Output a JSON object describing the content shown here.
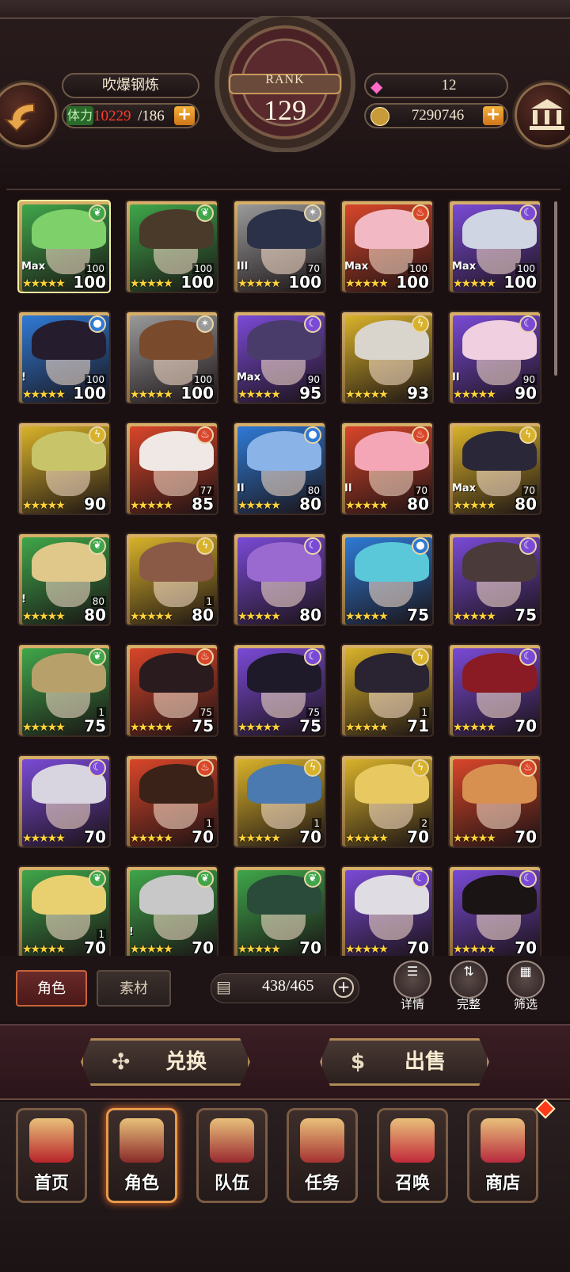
{
  "header": {
    "player_name": "吹爆钢炼",
    "stamina_label": "体力",
    "stamina_current": "10229",
    "stamina_max": "/186",
    "rank_label": "RANK",
    "rank_value": "129",
    "gems": "12",
    "gold": "7290746",
    "plus": "+"
  },
  "cards": [
    {
      "elem": "leaf",
      "star": 5,
      "level": "100",
      "cap": "100",
      "tag": "Max",
      "color": "#7ed06a"
    },
    {
      "elem": "leaf",
      "star": 5,
      "level": "100",
      "cap": "100",
      "tag": "",
      "color": "#4a3a2a"
    },
    {
      "elem": "light",
      "star": 5,
      "level": "100",
      "cap": "70",
      "tag": "III",
      "color": "#2a3148"
    },
    {
      "elem": "fire",
      "star": 5,
      "level": "100",
      "cap": "100",
      "tag": "Max",
      "color": "#f2b8c4"
    },
    {
      "elem": "moon",
      "star": 5,
      "level": "100",
      "cap": "100",
      "tag": "Max",
      "color": "#cfd5e3"
    },
    {
      "elem": "water",
      "star": 5,
      "level": "100",
      "cap": "100",
      "tag": "!",
      "color": "#251d2e"
    },
    {
      "elem": "light",
      "star": 5,
      "level": "100",
      "cap": "100",
      "tag": "",
      "color": "#7a4a2c"
    },
    {
      "elem": "moon",
      "star": 5,
      "level": "95",
      "cap": "90",
      "tag": "Max",
      "color": "#4a3c6a"
    },
    {
      "elem": "thunder",
      "star": 5,
      "level": "93",
      "cap": "",
      "tag": "",
      "color": "#d9d4cc"
    },
    {
      "elem": "moon",
      "star": 5,
      "level": "90",
      "cap": "90",
      "tag": "II",
      "color": "#f0cfe0"
    },
    {
      "elem": "thunder",
      "star": 5,
      "level": "90",
      "cap": "",
      "tag": "",
      "color": "#c8c46a"
    },
    {
      "elem": "fire",
      "star": 5,
      "level": "85",
      "cap": "77",
      "tag": "",
      "color": "#f0e8e4"
    },
    {
      "elem": "water",
      "star": 5,
      "level": "80",
      "cap": "80",
      "tag": "II",
      "color": "#8ab4e8"
    },
    {
      "elem": "fire",
      "star": 5,
      "level": "80",
      "cap": "70",
      "tag": "II",
      "color": "#f4a6b6"
    },
    {
      "elem": "thunder",
      "star": 5,
      "level": "80",
      "cap": "70",
      "tag": "Max",
      "color": "#2a2838"
    },
    {
      "elem": "leaf",
      "star": 5,
      "level": "80",
      "cap": "80",
      "tag": "!",
      "color": "#e0c88a"
    },
    {
      "elem": "thunder",
      "star": 5,
      "level": "80",
      "cap": "1",
      "tag": "",
      "color": "#8a5a46"
    },
    {
      "elem": "moon",
      "star": 5,
      "level": "80",
      "cap": "",
      "tag": "",
      "color": "#9a6ad0"
    },
    {
      "elem": "water",
      "star": 5,
      "level": "75",
      "cap": "",
      "tag": "",
      "color": "#5ac8d8"
    },
    {
      "elem": "moon",
      "star": 5,
      "level": "75",
      "cap": "",
      "tag": "",
      "color": "#4a3a3a"
    },
    {
      "elem": "leaf",
      "star": 5,
      "level": "75",
      "cap": "1",
      "tag": "",
      "color": "#b8a06a"
    },
    {
      "elem": "fire",
      "star": 5,
      "level": "75",
      "cap": "75",
      "tag": "",
      "color": "#2a1c1e"
    },
    {
      "elem": "moon",
      "star": 5,
      "level": "75",
      "cap": "75",
      "tag": "",
      "color": "#1e1a2a"
    },
    {
      "elem": "thunder",
      "star": 5,
      "level": "71",
      "cap": "1",
      "tag": "",
      "color": "#2a2432"
    },
    {
      "elem": "moon",
      "star": 5,
      "level": "70",
      "cap": "",
      "tag": "",
      "color": "#8a1a24"
    },
    {
      "elem": "moon",
      "star": 5,
      "level": "70",
      "cap": "",
      "tag": "",
      "color": "#d8d4e0"
    },
    {
      "elem": "fire",
      "star": 5,
      "level": "70",
      "cap": "1",
      "tag": "",
      "color": "#3a2218"
    },
    {
      "elem": "thunder",
      "star": 5,
      "level": "70",
      "cap": "1",
      "tag": "",
      "color": "#4a7ab0"
    },
    {
      "elem": "thunder",
      "star": 5,
      "level": "70",
      "cap": "2",
      "tag": "",
      "color": "#e8c860"
    },
    {
      "elem": "fire",
      "star": 5,
      "level": "70",
      "cap": "",
      "tag": "",
      "color": "#d89050"
    },
    {
      "elem": "leaf",
      "star": 5,
      "level": "70",
      "cap": "1",
      "tag": "",
      "color": "#e8d070"
    },
    {
      "elem": "leaf",
      "star": 5,
      "level": "70",
      "cap": "",
      "tag": "!",
      "color": "#c8c8c8"
    },
    {
      "elem": "leaf",
      "star": 5,
      "level": "70",
      "cap": "",
      "tag": "",
      "color": "#2a4a3a"
    },
    {
      "elem": "moon",
      "star": 5,
      "level": "70",
      "cap": "",
      "tag": "",
      "color": "#e0dce4"
    },
    {
      "elem": "moon",
      "star": 5,
      "level": "70",
      "cap": "",
      "tag": "",
      "color": "#1a1414"
    }
  ],
  "toolbar": {
    "tab_character": "角色",
    "tab_material": "素材",
    "card_count": "438/465",
    "detail": "详情",
    "complete": "完整",
    "filter": "筛选"
  },
  "actions": {
    "exchange": "兑换",
    "sell": "出售"
  },
  "nav": [
    {
      "label": "首页",
      "icon": "home-banner-icon"
    },
    {
      "label": "角色",
      "icon": "character-icon"
    },
    {
      "label": "队伍",
      "icon": "team-icon"
    },
    {
      "label": "任务",
      "icon": "quest-book-icon"
    },
    {
      "label": "召唤",
      "icon": "summon-card-icon"
    },
    {
      "label": "商店",
      "icon": "shop-gem-icon"
    }
  ],
  "colors": {
    "leaf": "#3fa64a",
    "fire": "#d9462a",
    "water": "#2f7ad6",
    "thunder": "#d8b22a",
    "moon": "#7a4ad6",
    "light": "#9a9a9a"
  }
}
